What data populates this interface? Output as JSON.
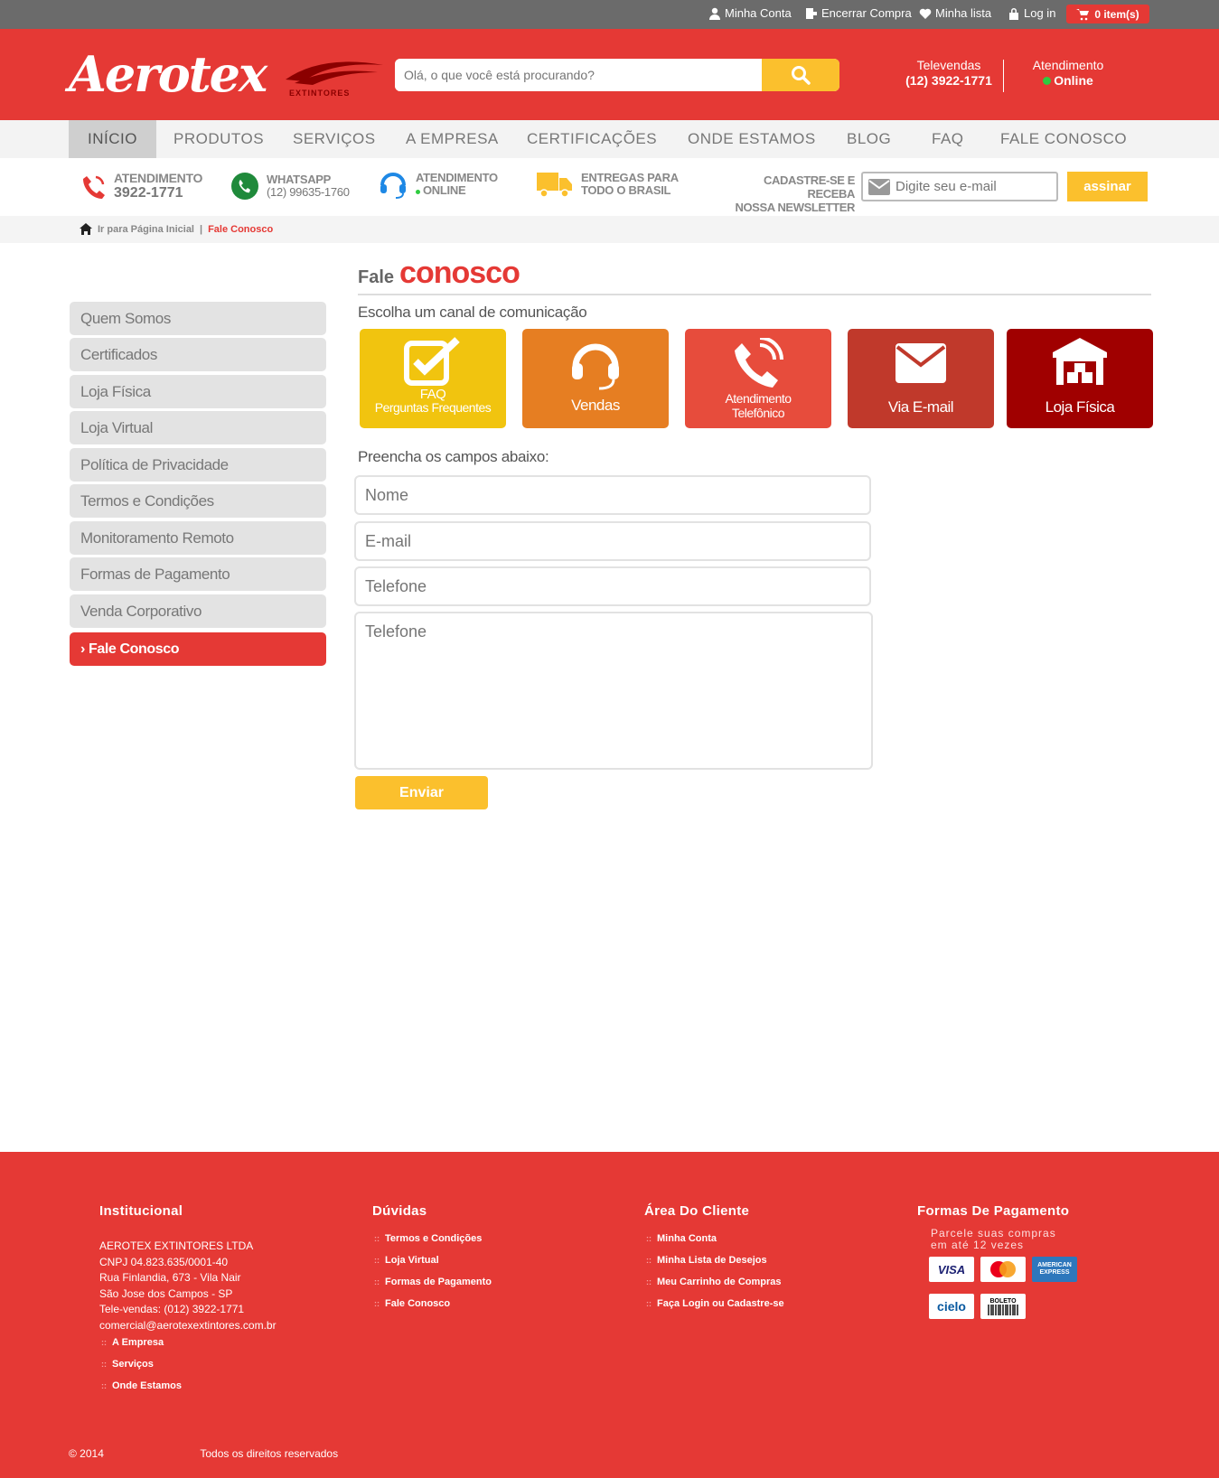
{
  "topbar": {
    "minha_conta": "Minha Conta",
    "encerrar": "Encerrar Compra",
    "minha_lista": "Minha lista",
    "login": "Log in",
    "cart": "0 item(s)"
  },
  "header": {
    "logo_text": "Aerotex",
    "logo_sub": "EXTINTORES",
    "search_placeholder": "Olá, o que você está procurando?",
    "televendas_label": "Televendas",
    "televendas_phone": "(12) 3922-1771",
    "atendimento_label": "Atendimento",
    "atendimento_status": "Online"
  },
  "nav": [
    "INÍCIO",
    "PRODUTOS",
    "SERVIÇOS",
    "A EMPRESA",
    "CERTIFICAÇÕES",
    "ONDE ESTAMOS",
    "BLOG",
    "FAQ",
    "FALE CONOSCO"
  ],
  "info": {
    "atendimento_label": "ATENDIMENTO",
    "atendimento_phone": "3922-1771",
    "whatsapp_label": "WHATSAPP",
    "whatsapp_phone": "(12) 99635-1760",
    "online_label_1": "ATENDIMENTO",
    "online_label_2": "ONLINE",
    "entregas_1": "ENTREGAS PARA",
    "entregas_2": "TODO O BRASIL",
    "newsletter_1": "CADASTRE-SE  E RECEBA",
    "newsletter_2": "NOSSA  NEWSLETTER",
    "email_placeholder": "Digite seu e-mail",
    "assinar": "assinar"
  },
  "breadcrumb": {
    "home": "Ir para Página Inicial",
    "sep": "|",
    "current": "Fale Conosco"
  },
  "sidebar": [
    "Quem Somos",
    "Certificados",
    "Loja Física",
    "Loja Virtual",
    "Política de Privacidade",
    "Termos e Condições",
    "Monitoramento Remoto",
    "Formas de Pagamento",
    "Venda Corporativo"
  ],
  "sidebar_active": "Fale Conosco",
  "main": {
    "title_1": "Fale",
    "title_2": "conosco",
    "choose": "Escolha um canal de comunicação",
    "fill": "Preencha os campos abaixo:",
    "channels": {
      "faq_1": "FAQ",
      "faq_2": "Perguntas Frequentes",
      "vendas": "Vendas",
      "tel_1": "Atendimento",
      "tel_2": "Telefônico",
      "email": "Via E-mail",
      "loja": "Loja Física"
    },
    "form": {
      "nome": "Nome",
      "email": "E-mail",
      "telefone": "Telefone",
      "mensagem": "Telefone",
      "enviar": "Enviar"
    }
  },
  "footer": {
    "institucional": "Institucional",
    "duvidas": "Dúvidas",
    "area": "Área Do Cliente",
    "formas": "Formas De Pagamento",
    "address": [
      "AEROTEX EXTINTORES LTDA",
      "CNPJ  04.823.635/0001-40",
      "Rua Finlandia, 673 - Vila Nair",
      "São Jose dos Campos - SP",
      "Tele-vendas: (012) 3922-1771",
      "comercial@aerotexextintores.com.br"
    ],
    "inst_links": [
      "A Empresa",
      "Serviços",
      "Onde Estamos"
    ],
    "duvidas_links": [
      "Termos e Condições",
      "Loja Virtual",
      "Formas de Pagamento",
      "Fale Conosco"
    ],
    "area_links": [
      "Minha Conta",
      "Minha Lista de Desejos",
      "Meu Carrinho de Compras",
      "Faça Login ou Cadastre-se"
    ],
    "parcele_1": "Parcele suas compras",
    "parcele_2": "em até 12 vezes",
    "payments": [
      "VISA",
      "Mastercard",
      "AMERICAN EXPRESS",
      "cielo",
      "BOLETO"
    ],
    "copyright": "© 2014",
    "rights": "Todos os direitos reservados"
  },
  "colors": {
    "brand_red": "#e53935",
    "yellow": "#fbc02d",
    "orange": "#e67e22",
    "dark_red": "#c0392b",
    "maroon": "#a00000"
  }
}
